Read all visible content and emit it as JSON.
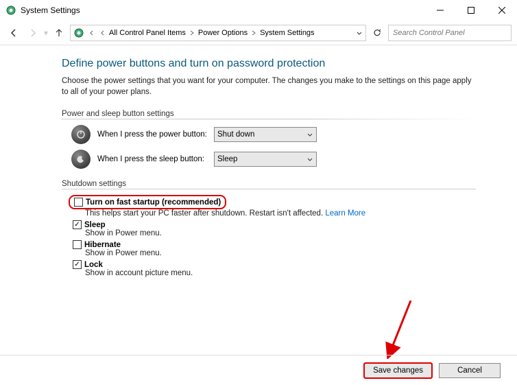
{
  "window": {
    "title": "System Settings"
  },
  "breadcrumb": {
    "items": [
      "All Control Panel Items",
      "Power Options",
      "System Settings"
    ]
  },
  "search": {
    "placeholder": "Search Control Panel"
  },
  "page": {
    "title": "Define power buttons and turn on password protection",
    "description": "Choose the power settings that you want for your computer. The changes you make to the settings on this page apply to all of your power plans."
  },
  "button_settings": {
    "header": "Power and sleep button settings",
    "power_label": "When I press the power button:",
    "power_value": "Shut down",
    "sleep_label": "When I press the sleep button:",
    "sleep_value": "Sleep"
  },
  "shutdown": {
    "header": "Shutdown settings",
    "items": [
      {
        "label": "Turn on fast startup (recommended)",
        "checked": false,
        "desc": "This helps start your PC faster after shutdown. Restart isn't affected. ",
        "link": "Learn More"
      },
      {
        "label": "Sleep",
        "checked": true,
        "desc": "Show in Power menu."
      },
      {
        "label": "Hibernate",
        "checked": false,
        "desc": "Show in Power menu."
      },
      {
        "label": "Lock",
        "checked": true,
        "desc": "Show in account picture menu."
      }
    ]
  },
  "footer": {
    "save": "Save changes",
    "cancel": "Cancel"
  }
}
